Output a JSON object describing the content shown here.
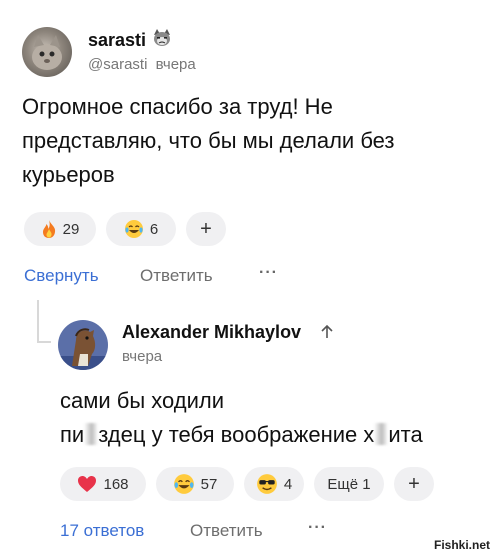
{
  "comment": {
    "username": "sarasti",
    "handle": "@sarasti",
    "time": "вчера",
    "text_lines": [
      "Огромное спасибо за труд! Не",
      "представляю, что бы мы делали без",
      "курьеров"
    ],
    "reactions": [
      {
        "icon": "fire-icon",
        "count": "29"
      },
      {
        "icon": "laughing-tears-emoji-icon",
        "count": "6"
      }
    ],
    "add_reaction": "+",
    "collapse_label": "Свернуть",
    "reply_label": "Ответить",
    "more": "···"
  },
  "reply": {
    "username": "Alexander Mikhaylov",
    "time": "вчера",
    "text_line1": "сами бы ходили",
    "text_line2_a": "пи",
    "text_line2_b": "здец у тебя воображение х",
    "text_line2_c": "ита",
    "reactions": [
      {
        "icon": "heart-icon",
        "count": "168"
      },
      {
        "icon": "laughing-tears-emoji-icon",
        "count": "57"
      },
      {
        "icon": "sunglasses-emoji-icon",
        "count": "4"
      }
    ],
    "more_reactions": "Ещё 1",
    "add_reaction": "+",
    "replies_label": "17 ответов",
    "reply_label": "Ответить",
    "more": "···"
  },
  "watermark": "Fishki.net",
  "colors": {
    "link": "#3b6fd4",
    "chip_bg": "#f0f0f2",
    "muted": "#6e6e6e"
  }
}
